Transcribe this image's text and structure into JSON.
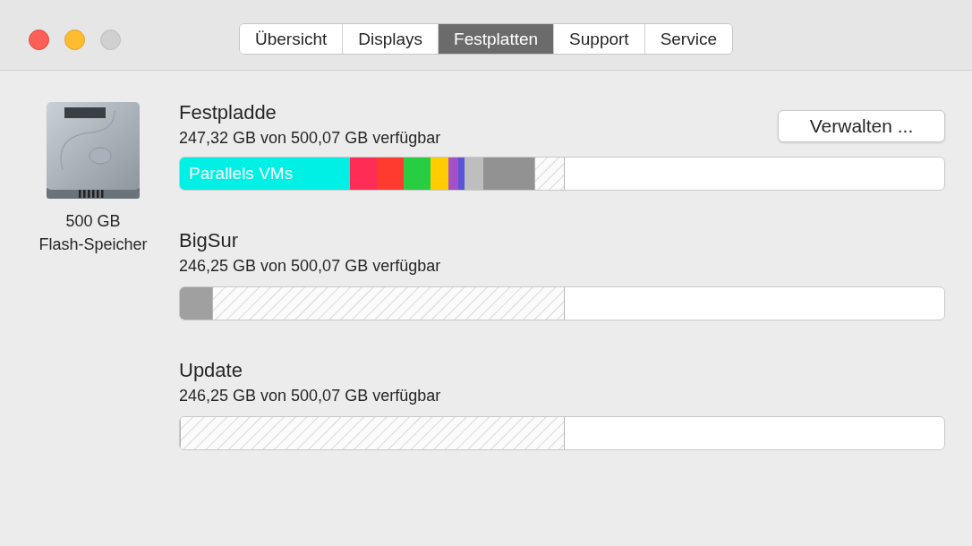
{
  "tabs": [
    {
      "label": "Übersicht",
      "selected": false
    },
    {
      "label": "Displays",
      "selected": false
    },
    {
      "label": "Festplatten",
      "selected": true
    },
    {
      "label": "Support",
      "selected": false
    },
    {
      "label": "Service",
      "selected": false
    }
  ],
  "device": {
    "size": "500 GB",
    "type": "Flash-Speicher"
  },
  "manage_button": "Verwalten ...",
  "volumes": [
    {
      "name": "Festpladde",
      "available": "247,32 GB von 500,07 GB verfügbar",
      "segments": [
        {
          "kind": "color",
          "color": "#00f0e6",
          "label": "Parallels VMs"
        },
        {
          "kind": "color",
          "color": "#ff2d55"
        },
        {
          "kind": "color",
          "color": "#ff3b30"
        },
        {
          "kind": "color",
          "color": "#28cd41"
        },
        {
          "kind": "color",
          "color": "#ffcc00"
        },
        {
          "kind": "color",
          "color": "#a550c8"
        },
        {
          "kind": "color",
          "color": "#5856d6"
        },
        {
          "kind": "color",
          "color": "#bebebe"
        },
        {
          "kind": "color",
          "color": "#929292"
        },
        {
          "kind": "hatched"
        }
      ]
    },
    {
      "name": "BigSur",
      "available": "246,25 GB von 500,07 GB verfügbar",
      "segments": [
        {
          "kind": "color",
          "color": "#a0a0a0"
        },
        {
          "kind": "hatched"
        }
      ]
    },
    {
      "name": "Update",
      "available": "246,25 GB von 500,07 GB verfügbar",
      "segments": [
        {
          "kind": "hatched"
        }
      ]
    }
  ]
}
